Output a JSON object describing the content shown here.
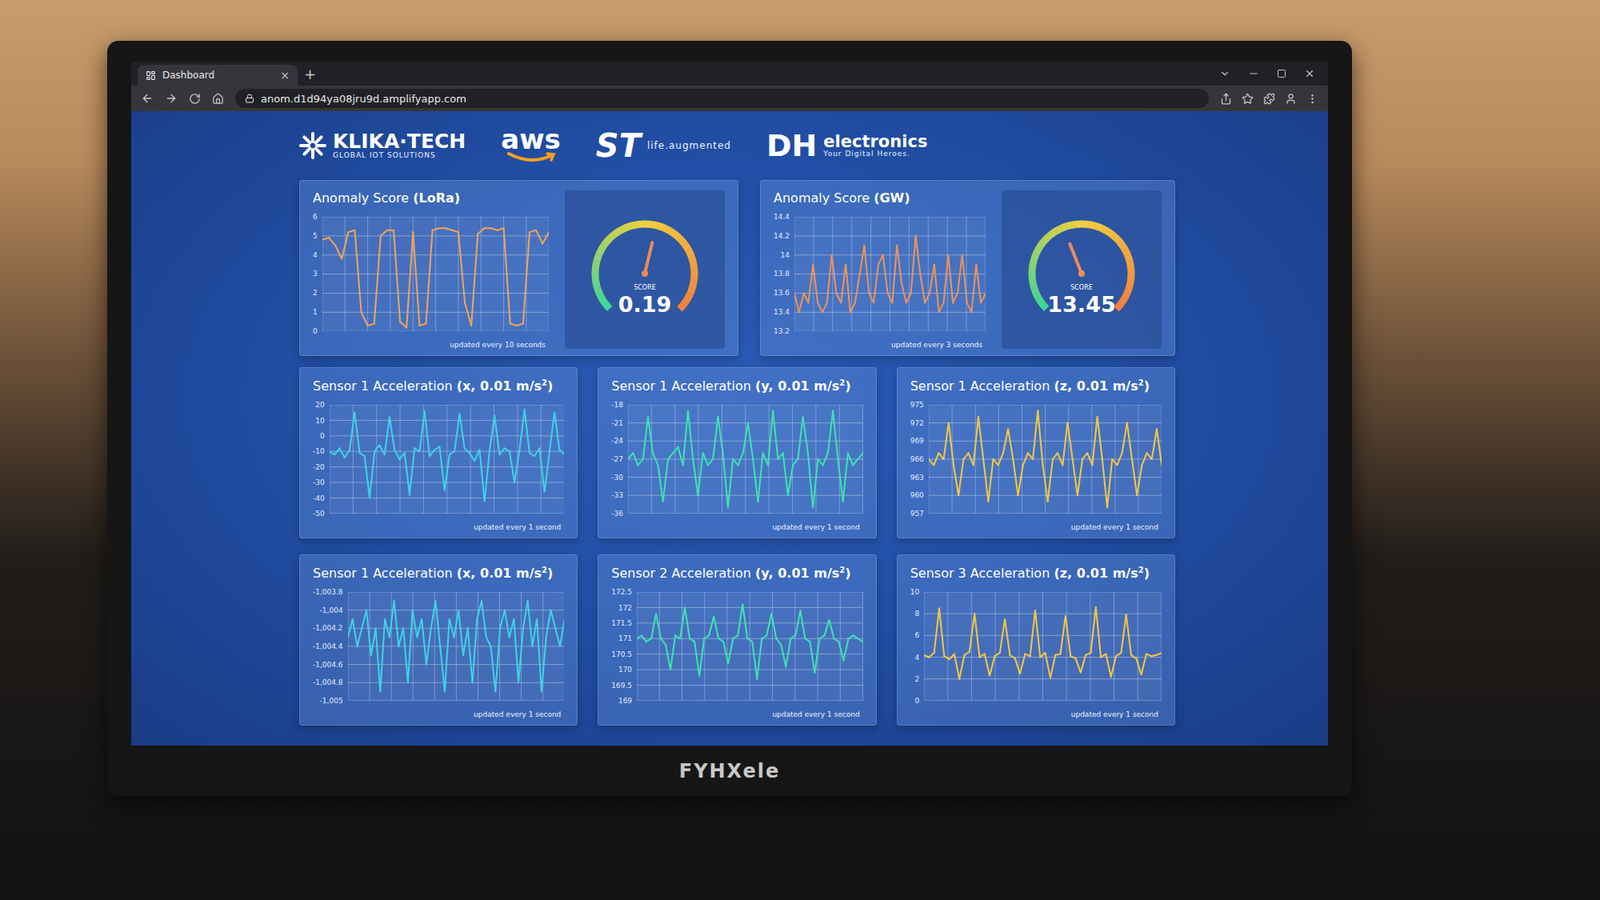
{
  "browser": {
    "tab": {
      "title": "Dashboard",
      "close": "×"
    },
    "new_tab": "+",
    "url": "anom.d1d94ya08jru9d.amplifyapp.com"
  },
  "logos": {
    "klika": {
      "name": "KLIKA·TECH",
      "tagline": "GLOBAL IOT SOLUTIONS"
    },
    "aws": {
      "name": "aws"
    },
    "st": {
      "name": "ST",
      "tagline": "life.augmented"
    },
    "dh": {
      "mark": "DH",
      "name": "electronics",
      "tagline": "Your Digital Heroes."
    }
  },
  "anomaly_panels": [
    {
      "title": "Anomaly Score",
      "source": "(LoRa)",
      "ticks": [
        "6",
        "5",
        "4",
        "3",
        "2",
        "1",
        "0"
      ],
      "values": [
        4.8,
        4.9,
        4.5,
        3.8,
        5.2,
        5.3,
        1,
        0.3,
        0.4,
        5,
        5.3,
        5.3,
        0.5,
        0.2,
        5.2,
        0.3,
        0.4,
        5.3,
        5.4,
        5.4,
        5.3,
        5.2,
        1.5,
        0.3,
        5.1,
        5.4,
        5.4,
        5.3,
        5.4,
        0.4,
        0.3,
        0.4,
        5.2,
        5.3,
        4.6,
        5.2
      ],
      "color": "#f2a45a",
      "footer": "updated every 10 seconds",
      "gauge": {
        "label": "SCORE",
        "score": "0.19",
        "level": 0.55
      }
    },
    {
      "title": "Anomaly Score",
      "source": "(GW)",
      "ticks": [
        "14.4",
        "14.2",
        "14",
        "13.8",
        "13.6",
        "13.4",
        "13.2"
      ],
      "values": [
        13.6,
        13.4,
        13.6,
        13.5,
        13.9,
        13.5,
        13.4,
        13.5,
        14,
        13.6,
        13.5,
        13.9,
        13.4,
        13.5,
        13.8,
        14.1,
        13.6,
        13.5,
        13.9,
        14,
        13.6,
        13.5,
        14.1,
        13.7,
        13.5,
        13.6,
        14.2,
        13.8,
        13.5,
        13.6,
        13.9,
        13.4,
        13.5,
        14,
        13.5,
        13.6,
        14,
        13.5,
        13.4,
        13.9,
        13.5,
        13.6
      ],
      "color": "#f0935a",
      "footer": "updated every 3 seconds",
      "gauge": {
        "label": "SCORE",
        "score": "13.45",
        "level": 0.42
      }
    }
  ],
  "sensor_panels": [
    {
      "name": "Sensor 1 Acceleration",
      "detail": "(x, 0.01 m/s",
      "sup": "2",
      "close": ")",
      "ticks": [
        "20",
        "10",
        "0",
        "-10",
        "-20",
        "-30",
        "-40",
        "-50"
      ],
      "values": [
        -10,
        -12,
        -8,
        -14,
        -9,
        15,
        -11,
        -13,
        -40,
        -10,
        -6,
        -12,
        12,
        -9,
        -15,
        -11,
        -38,
        -8,
        -10,
        16,
        -13,
        -9,
        -7,
        -35,
        -12,
        -10,
        14,
        -8,
        -11,
        -16,
        -9,
        -42,
        -10,
        13,
        -12,
        -8,
        -10,
        -30,
        -9,
        17,
        -11,
        -13,
        -8,
        -36,
        -10,
        15,
        -9,
        -12
      ],
      "color": "#3fd3e6",
      "footer": "updated every 1 second"
    },
    {
      "name": "Sensor 1 Acceleration",
      "detail": "(y, 0.01 m/s",
      "sup": "2",
      "close": ")",
      "ticks": [
        "-18",
        "-21",
        "-24",
        "-27",
        "-30",
        "-33",
        "-36"
      ],
      "values": [
        -27,
        -26,
        -28,
        -27,
        -20,
        -26,
        -28,
        -34,
        -27,
        -26,
        -25,
        -28,
        -19,
        -27,
        -33,
        -26,
        -28,
        -27,
        -20,
        -26,
        -35,
        -27,
        -28,
        -26,
        -21,
        -27,
        -34,
        -26,
        -28,
        -19,
        -27,
        -26,
        -33,
        -28,
        -27,
        -20,
        -26,
        -35,
        -27,
        -28,
        -26,
        -19,
        -27,
        -34,
        -26,
        -28,
        -27,
        -26
      ],
      "color": "#3ee3b0",
      "footer": "updated every 1 second"
    },
    {
      "name": "Sensor 1 Acceleration",
      "detail": "(z, 0.01 m/s",
      "sup": "2",
      "close": ")",
      "ticks": [
        "975",
        "972",
        "969",
        "966",
        "963",
        "960",
        "957"
      ],
      "values": [
        966,
        965,
        967,
        966,
        972,
        965,
        960,
        966,
        967,
        965,
        973,
        966,
        959,
        966,
        965,
        967,
        971,
        966,
        960,
        965,
        967,
        966,
        974,
        965,
        959,
        966,
        967,
        965,
        972,
        966,
        960,
        966,
        967,
        965,
        973,
        966,
        958,
        966,
        965,
        967,
        972,
        966,
        960,
        965,
        967,
        966,
        971,
        965
      ],
      "color": "#f5c842",
      "footer": "updated every 1 second"
    },
    {
      "name": "Sensor 1 Acceleration",
      "detail": "(x, 0.01 m/s",
      "sup": "2",
      "close": ")",
      "ticks": [
        "-1,003.8",
        "-1,004",
        "-1,004.2",
        "-1,004.4",
        "-1,004.6",
        "-1,004.8",
        "-1,005"
      ],
      "values": [
        -1004.3,
        -1004.1,
        -1004.4,
        -1004.2,
        -1004.0,
        -1004.5,
        -1004.2,
        -1004.9,
        -1004.1,
        -1004.3,
        -1003.9,
        -1004.4,
        -1004.2,
        -1004.8,
        -1004.0,
        -1004.3,
        -1004.1,
        -1004.6,
        -1004.2,
        -1003.9,
        -1004.4,
        -1004.9,
        -1004.1,
        -1004.3,
        -1004.0,
        -1004.5,
        -1004.2,
        -1004.8,
        -1004.1,
        -1003.9,
        -1004.3,
        -1004.4,
        -1004.9,
        -1004.2,
        -1004.0,
        -1004.3,
        -1004.1,
        -1004.8,
        -1004.2,
        -1003.9,
        -1004.4,
        -1004.1,
        -1004.9,
        -1004.3,
        -1004.0,
        -1004.2,
        -1004.4,
        -1004.1
      ],
      "color": "#3fd3e6",
      "footer": "updated every 1 second"
    },
    {
      "name": "Sensor 2 Acceleration",
      "detail": "(y, 0.01 m/s",
      "sup": "2",
      "close": ")",
      "ticks": [
        "172.5",
        "172",
        "171.5",
        "171",
        "170.5",
        "170",
        "169.5",
        "169"
      ],
      "values": [
        171,
        171.1,
        170.9,
        171,
        171.8,
        171,
        170.8,
        170,
        171.1,
        171,
        172,
        171,
        170.9,
        169.8,
        171,
        171.1,
        171.7,
        171,
        170.9,
        170.2,
        171,
        171.1,
        172.1,
        171,
        170.9,
        169.7,
        171,
        171.1,
        171.8,
        171,
        170.8,
        170.1,
        171,
        171.1,
        171.9,
        171,
        170.9,
        169.9,
        171,
        171.1,
        171.6,
        171,
        170.9,
        170.3,
        171,
        171.1,
        171,
        170.9
      ],
      "color": "#3ee3b0",
      "footer": "updated every 1 second"
    },
    {
      "name": "Sensor 3 Acceleration",
      "detail": "(z, 0.01 m/s",
      "sup": "2",
      "close": ")",
      "ticks": [
        "10",
        "8",
        "6",
        "4",
        "2",
        "0"
      ],
      "values": [
        4.2,
        4,
        4.4,
        8.5,
        4.1,
        3.8,
        4.3,
        2,
        4.2,
        4.5,
        8,
        4,
        4.3,
        2.3,
        4.1,
        4.4,
        7.5,
        4.2,
        3.9,
        2.5,
        4.3,
        4.1,
        8.3,
        4,
        4.4,
        2.1,
        4.2,
        4.3,
        7.8,
        4.1,
        3.9,
        2.6,
        4.2,
        4.4,
        8.6,
        4,
        4.3,
        2.2,
        4.1,
        4.4,
        7.9,
        4.2,
        3.9,
        2.4,
        4.3,
        4.1,
        4.2,
        4.4
      ],
      "color": "#f5c842",
      "footer": "updated every 1 second"
    }
  ],
  "monitor": {
    "brand": "FYHXele"
  }
}
